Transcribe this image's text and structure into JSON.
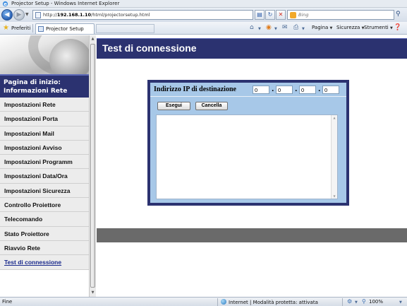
{
  "window": {
    "title": "Projector Setup - Windows Internet Explorer"
  },
  "address": {
    "url_prefix": "http://",
    "url_host": "192.168.1.10",
    "url_path": "/html/projectorsetup.html",
    "search_placeholder": "Bing"
  },
  "favorites": {
    "label": "Preferiti",
    "tab_title": "Projector Setup"
  },
  "commands": {
    "page": "Pagina",
    "security": "Sicurezza",
    "tools": "Strumenti"
  },
  "sidebar": {
    "home_line1": "Pagina di inizio:",
    "home_line2": "Informazioni Rete",
    "items": [
      {
        "label": "Impostazioni Rete"
      },
      {
        "label": "Impostazioni Porta"
      },
      {
        "label": "Impostazioni Mail"
      },
      {
        "label": "Impostazioni Avviso"
      },
      {
        "label": "Impostazioni Programm"
      },
      {
        "label": "Impostazioni Data/Ora"
      },
      {
        "label": "Impostazioni Sicurezza"
      },
      {
        "label": "Controllo Proiettore"
      },
      {
        "label": "Telecomando"
      },
      {
        "label": "Stato Proiettore"
      },
      {
        "label": "Riavvio Rete"
      },
      {
        "label": "Test di connessione",
        "active": true
      }
    ]
  },
  "main": {
    "title": "Test di connessione",
    "ip_label": "Indirizzo IP di destinazione",
    "ip_octets": [
      "0",
      "0",
      "0",
      "0"
    ],
    "run_button": "Esegui",
    "cancel_button": "Cancella"
  },
  "status": {
    "left": "Fine",
    "zone": "Internet | Modalità protetta: attivata",
    "zoom": "100%"
  },
  "colors": {
    "header_navy": "#2b3270",
    "panel_light_blue": "#a7c8e8",
    "menu_bg": "#ececec",
    "band_gray": "#6a6a6a"
  }
}
